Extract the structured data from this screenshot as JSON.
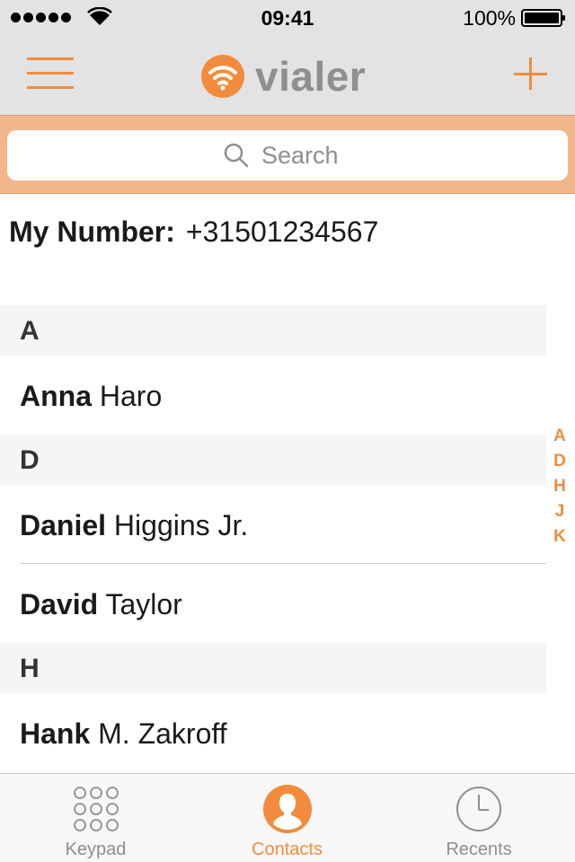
{
  "status_bar": {
    "time": "09:41",
    "battery": "100%"
  },
  "nav": {
    "brand": "vialer"
  },
  "search": {
    "placeholder": "Search"
  },
  "my_number": {
    "label": "My Number:",
    "value": "+31501234567"
  },
  "sections": [
    {
      "letter": "A",
      "contacts": [
        {
          "first": "Anna",
          "last": "Haro"
        }
      ]
    },
    {
      "letter": "D",
      "contacts": [
        {
          "first": "Daniel",
          "last": "Higgins Jr."
        },
        {
          "first": "David",
          "last": "Taylor"
        }
      ]
    },
    {
      "letter": "H",
      "contacts": [
        {
          "first": "Hank",
          "last": "M. Zakroff"
        }
      ]
    }
  ],
  "index": [
    "A",
    "D",
    "H",
    "J",
    "K"
  ],
  "tabs": [
    {
      "label": "Keypad",
      "icon": "keypad-icon",
      "active": false
    },
    {
      "label": "Contacts",
      "icon": "contacts-icon",
      "active": true
    },
    {
      "label": "Recents",
      "icon": "clock-icon",
      "active": false
    }
  ],
  "colors": {
    "accent": "#f28c3c",
    "search_bg": "#f2b68b",
    "bar_bg": "#e3e3e3"
  }
}
